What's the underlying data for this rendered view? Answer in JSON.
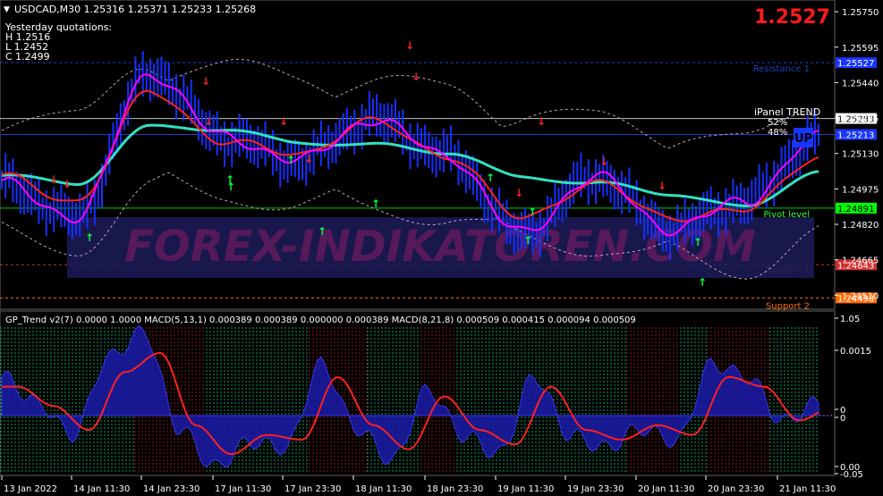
{
  "header": {
    "symbol_line": "USDCAD,M30  1.25316  1.25371  1.25233  1.25268",
    "big_price": "1.2527"
  },
  "yesterday": {
    "title": "Yesterday quotations:",
    "high": "H 1.2516",
    "low": "L 1.2452",
    "close": "C 1.2499"
  },
  "ipanel": {
    "title": "iPanel  TREND",
    "pct_up": "52%",
    "pct_down": "48%"
  },
  "watermark": "FOREX-INDIKATOREN.COM",
  "levels": [
    {
      "label": "Resistance 1",
      "value": "1.25527",
      "color": "#1f3fbf",
      "label_color": "#1f3fbf",
      "tag_bg": "#1a35ff",
      "y_price": 1.25527
    },
    {
      "label": "",
      "value": "1.25283",
      "color": "#c0c0c0",
      "label_color": "#ffffff",
      "tag_bg": "#ffffff",
      "y_price": 1.25283
    },
    {
      "label": "",
      "value": "1.25213",
      "color": "#1f3fbf",
      "label_color": "#1f3fbf",
      "tag_bg": "#1a35ff",
      "y_price": 1.25213
    },
    {
      "label": "Pivot level",
      "value": "1.24891",
      "color": "#00cc00",
      "label_color": "#33ff33",
      "tag_bg": "#00ff00",
      "y_price": 1.24891
    },
    {
      "label": "Support 1",
      "value": "1.24643",
      "color": "#c03030",
      "label_color": "#c03030",
      "tag_bg": "#d03030",
      "y_price": 1.24643
    },
    {
      "label": "Support 2",
      "value": "1.24498",
      "color": "#ff6a00",
      "label_color": "#ff6a00",
      "tag_bg": "#ff6a00",
      "y_price": 1.24498
    }
  ],
  "price_ticks": [
    "1.25750",
    "1.25595",
    "1.25440",
    "1.25285",
    "1.25130",
    "1.24975",
    "1.24820",
    "1.24665",
    "1.24510"
  ],
  "indicator": {
    "header": "GP_Trend v2(7) 0.0000 1.0000  MACD(5,13,1) 0.000389 0.000389 0.000000 0.000389  MACD(8,21,8) 0.000509 0.000415 0.000094 0.000509",
    "ticks": [
      "1.05",
      "0.0015",
      "0",
      "0",
      "0.00",
      "-0.05"
    ]
  },
  "time_labels": [
    "13 Jan 2022",
    "14 Jan 11:30",
    "14 Jan 23:30",
    "17 Jan 11:30",
    "17 Jan 23:30",
    "18 Jan 11:30",
    "18 Jan 23:30",
    "19 Jan 11:30",
    "19 Jan 23:30",
    "20 Jan 11:30",
    "20 Jan 23:30",
    "21 Jan 11:30"
  ],
  "colors": {
    "candles": "#1530ff",
    "ma_fast": "#ff00ff",
    "ma_mid": "#ff2020",
    "ma_slow": "#33e0c0",
    "bands": "#c0a0c0",
    "up_arrow": "#00ff40",
    "down_arrow": "#ff2020",
    "macd_fill": "#1a1aa0",
    "signal": "#ff2020",
    "bull_bar": "#10a060",
    "bear_bar": "#8a1a1a"
  },
  "chart_data": {
    "type": "line",
    "x": [
      "13 Jan 2022",
      "14 Jan 11:30",
      "14 Jan 23:30",
      "17 Jan 11:30",
      "17 Jan 23:30",
      "18 Jan 11:30",
      "18 Jan 23:30",
      "19 Jan 11:30",
      "19 Jan 23:30",
      "20 Jan 11:30",
      "20 Jan 23:30",
      "21 Jan 11:30"
    ],
    "ylim": [
      1.244,
      1.2577
    ],
    "series": [
      {
        "values": [
          1.25,
          1.2485,
          1.2548,
          1.252,
          1.251,
          1.2528,
          1.2512,
          1.2478,
          1.2503,
          1.248,
          1.2492,
          1.252
        ]
      },
      {
        "values": [
          1.2503,
          1.2492,
          1.254,
          1.2518,
          1.2513,
          1.2527,
          1.2512,
          1.2485,
          1.25,
          1.2485,
          1.2488,
          1.2512
        ]
      },
      {
        "values": [
          1.2503,
          1.25,
          1.2525,
          1.2523,
          1.2518,
          1.2517,
          1.2513,
          1.2503,
          1.25,
          1.2495,
          1.249,
          1.2505
        ]
      }
    ]
  }
}
